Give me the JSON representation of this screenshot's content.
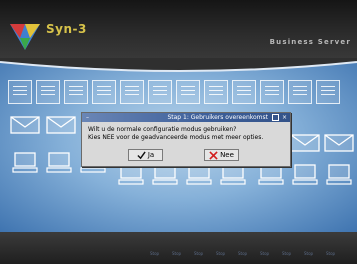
{
  "header": {
    "logo_text": "Syn-3",
    "tagline": "Business Server"
  },
  "dialog": {
    "title": "Stap 1: Gebruikers overeenkomst",
    "message_line1": "Wilt u de normale configuratie modus gebruiken?",
    "message_line2": "Kies NEE voor de geadvanceerde modus met meer opties.",
    "yes_label": "Ja",
    "no_label": "Nee"
  },
  "taskbar": {
    "items": [
      "Stop",
      "Stop",
      "Stop",
      "Stop",
      "Stop",
      "Stop",
      "Stop",
      "Stop",
      "Stop"
    ]
  },
  "colors": {
    "accent_title": "#3d5f9a",
    "logo_text": "#d6c24a",
    "background_blue": "#86b1d9"
  },
  "icons": {
    "yes": "check-icon",
    "no": "x-icon"
  }
}
